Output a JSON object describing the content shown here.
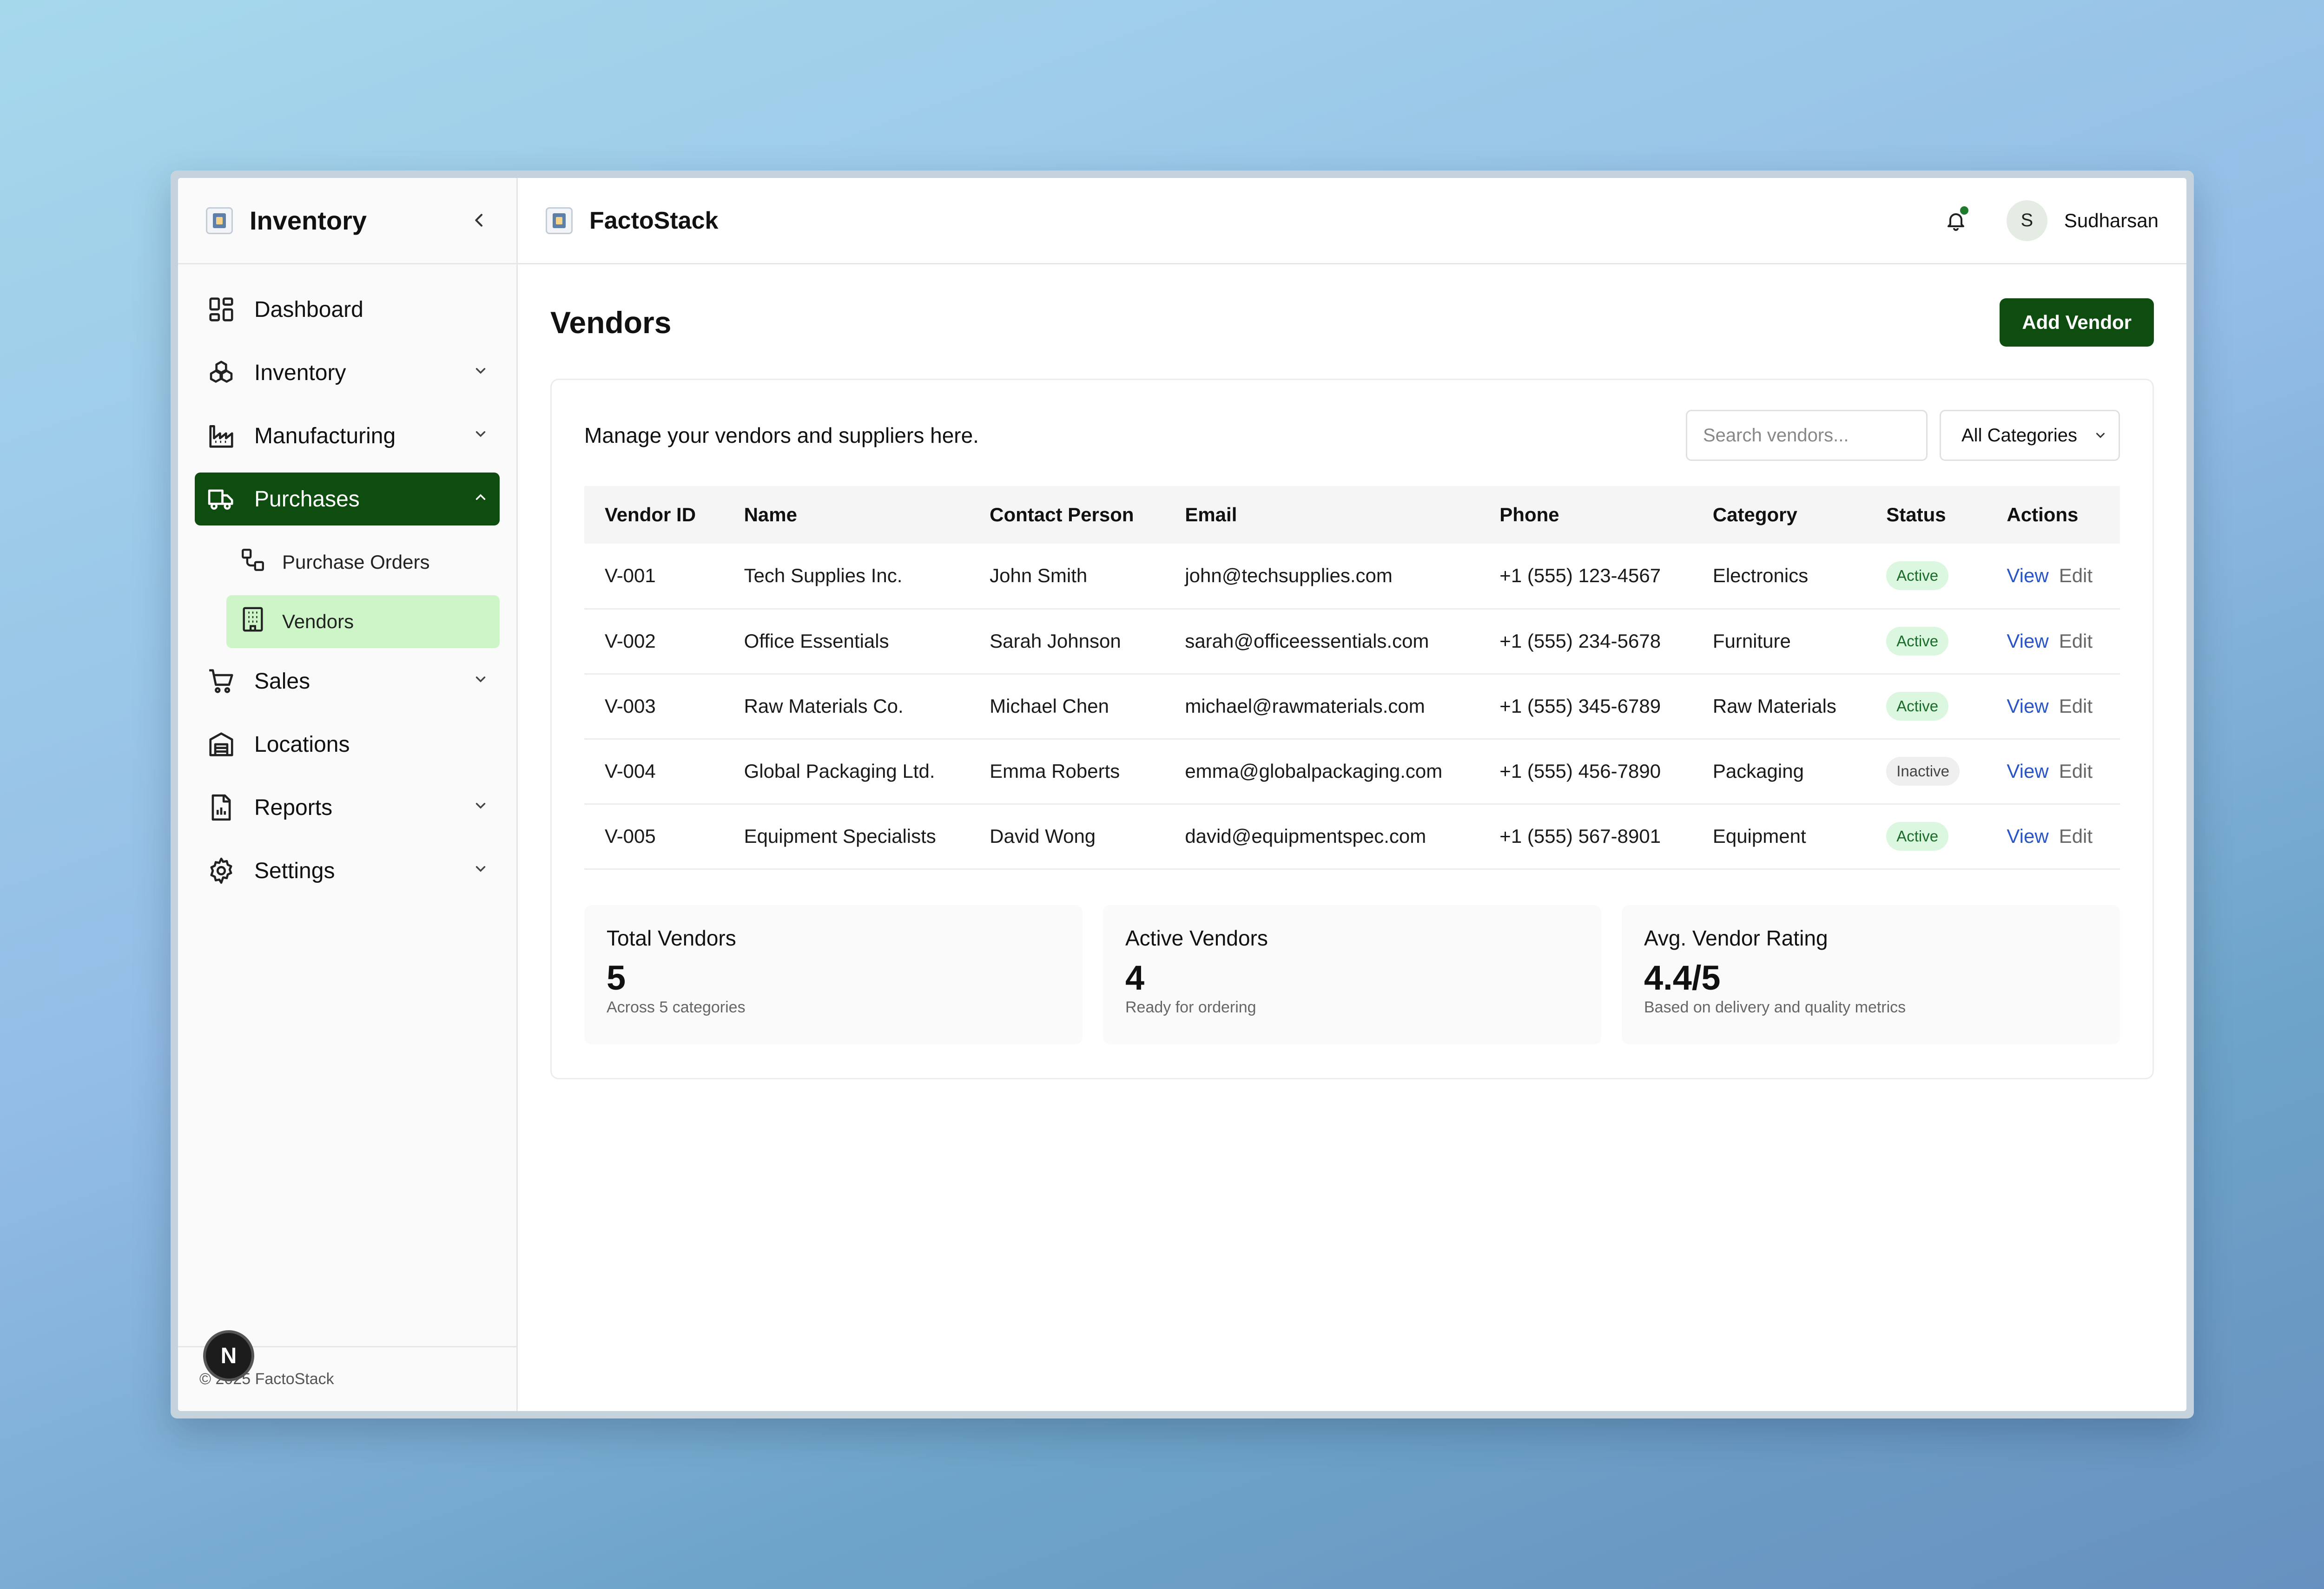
{
  "sidebar": {
    "title": "Inventory",
    "items": [
      {
        "label": "Dashboard"
      },
      {
        "label": "Inventory"
      },
      {
        "label": "Manufacturing"
      },
      {
        "label": "Purchases"
      },
      {
        "label": "Sales"
      },
      {
        "label": "Locations"
      },
      {
        "label": "Reports"
      },
      {
        "label": "Settings"
      }
    ],
    "subitems": [
      {
        "label": "Purchase Orders"
      },
      {
        "label": "Vendors"
      }
    ],
    "footer": "© 2025 FactoStack"
  },
  "fab": {
    "label": "N"
  },
  "header": {
    "brand": "FactoStack",
    "user_initial": "S",
    "user_name": "Sudharsan"
  },
  "page": {
    "title": "Vendors",
    "add_button": "Add Vendor",
    "description": "Manage your vendors and suppliers here.",
    "search_placeholder": "Search vendors...",
    "category_filter": "All Categories"
  },
  "table": {
    "headers": [
      "Vendor ID",
      "Name",
      "Contact Person",
      "Email",
      "Phone",
      "Category",
      "Status",
      "Actions"
    ],
    "rows": [
      {
        "id": "V-001",
        "name": "Tech Supplies Inc.",
        "contact": "John Smith",
        "email": "john@techsupplies.com",
        "phone": "+1 (555) 123-4567",
        "category": "Electronics",
        "status": "Active"
      },
      {
        "id": "V-002",
        "name": "Office Essentials",
        "contact": "Sarah Johnson",
        "email": "sarah@officeessentials.com",
        "phone": "+1 (555) 234-5678",
        "category": "Furniture",
        "status": "Active"
      },
      {
        "id": "V-003",
        "name": "Raw Materials Co.",
        "contact": "Michael Chen",
        "email": "michael@rawmaterials.com",
        "phone": "+1 (555) 345-6789",
        "category": "Raw Materials",
        "status": "Active"
      },
      {
        "id": "V-004",
        "name": "Global Packaging Ltd.",
        "contact": "Emma Roberts",
        "email": "emma@globalpackaging.com",
        "phone": "+1 (555) 456-7890",
        "category": "Packaging",
        "status": "Inactive"
      },
      {
        "id": "V-005",
        "name": "Equipment Specialists",
        "contact": "David Wong",
        "email": "david@equipmentspec.com",
        "phone": "+1 (555) 567-8901",
        "category": "Equipment",
        "status": "Active"
      }
    ],
    "view_label": "View",
    "edit_label": "Edit"
  },
  "stats": [
    {
      "label": "Total Vendors",
      "value": "5",
      "sub": "Across 5 categories"
    },
    {
      "label": "Active Vendors",
      "value": "4",
      "sub": "Ready for ordering"
    },
    {
      "label": "Avg. Vendor Rating",
      "value": "4.4/5",
      "sub": "Based on delivery and quality metrics"
    }
  ],
  "colors": {
    "primary": "#0e4d0f",
    "active_sub_bg": "#cdf5c8",
    "active_badge_bg": "#dcf7df",
    "link": "#2a55c6"
  },
  "icons": {
    "sidebar": [
      "dashboard-icon",
      "boxes-icon",
      "factory-icon",
      "truck-icon",
      "cart-icon",
      "warehouse-icon",
      "report-icon",
      "gear-icon"
    ],
    "sub": [
      "flow-icon",
      "building-icon"
    ],
    "header": [
      "bell-icon"
    ]
  }
}
